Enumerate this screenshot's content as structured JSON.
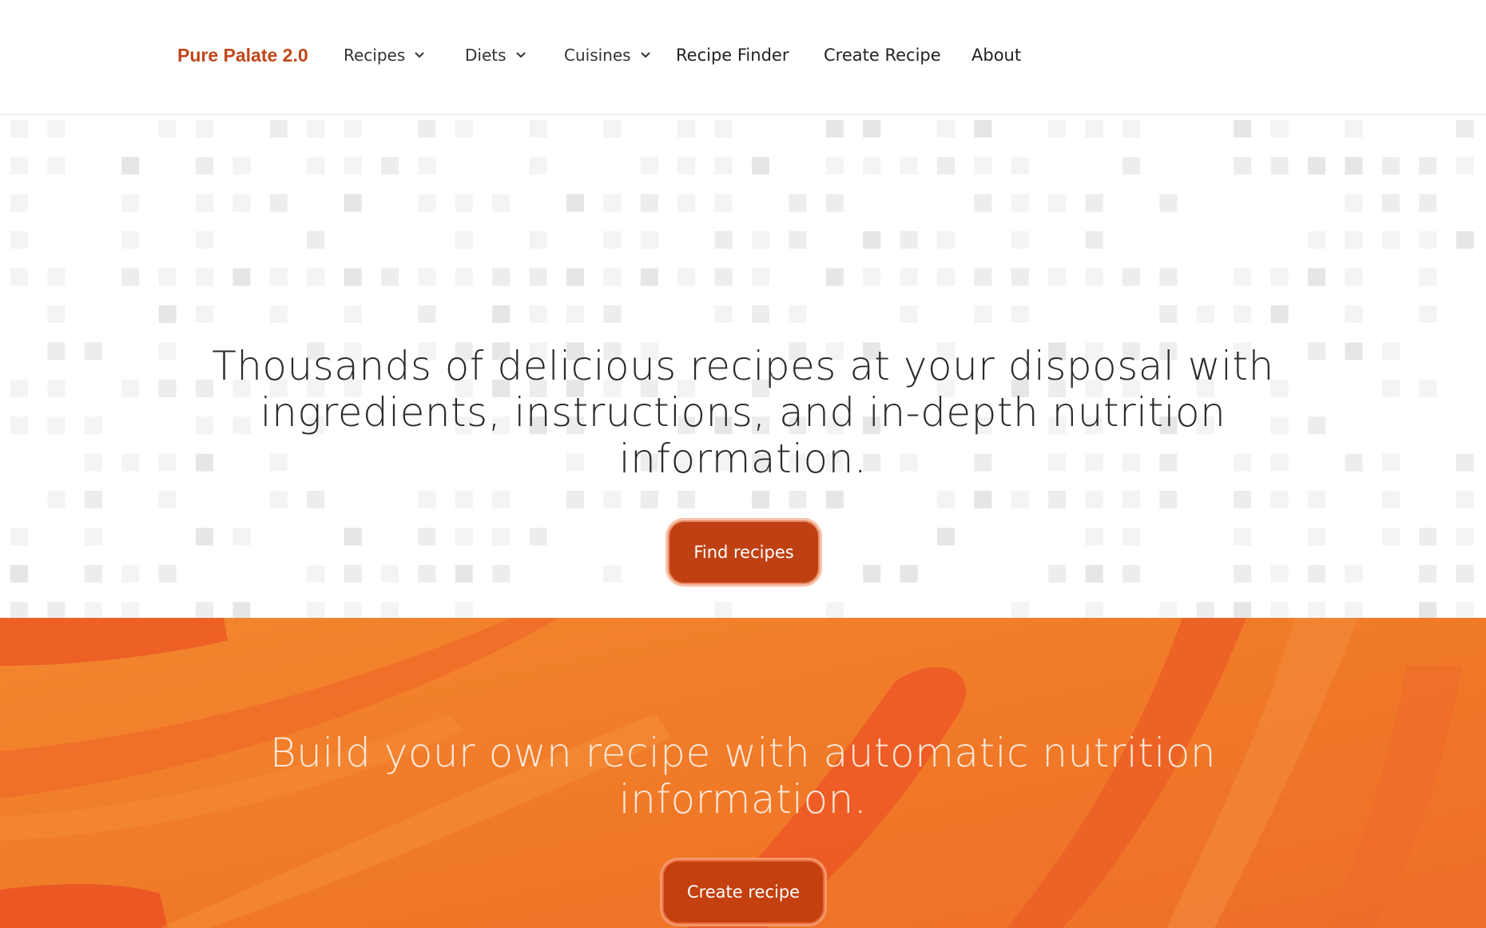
{
  "nav": {
    "brand": "Pure Palate 2.0",
    "items": [
      {
        "label": "Recipes",
        "has_dropdown": true
      },
      {
        "label": "Diets",
        "has_dropdown": true
      },
      {
        "label": "Cuisines",
        "has_dropdown": true
      },
      {
        "label": "Recipe Finder",
        "has_dropdown": false
      },
      {
        "label": "Create Recipe",
        "has_dropdown": false
      },
      {
        "label": "About",
        "has_dropdown": false
      }
    ]
  },
  "hero": {
    "heading": "Thousands of delicious recipes at your disposal with ingredients, instructions, and in-depth nutrition information.",
    "button_label": "Find recipes"
  },
  "build": {
    "heading": "Build your own recipe with automatic nutrition information.",
    "button_label": "Create recipe"
  },
  "colors": {
    "brand": "#c2461a",
    "primary_button": "#bf4113",
    "section_orange": "#f07a2a"
  },
  "icons": {
    "dropdown": "chevron-down-icon"
  }
}
